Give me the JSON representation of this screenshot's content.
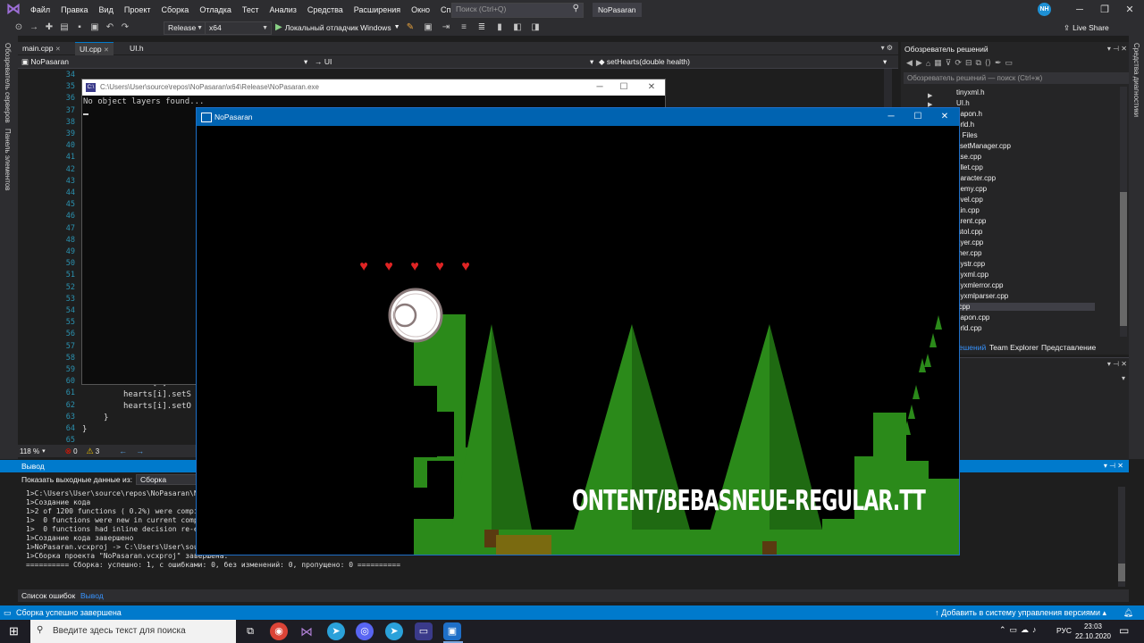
{
  "title_bar": {
    "menus": [
      "Файл",
      "Правка",
      "Вид",
      "Проект",
      "Сборка",
      "Отладка",
      "Тест",
      "Анализ",
      "Средства",
      "Расширения",
      "Окно",
      "Справка"
    ],
    "search_placeholder": "Поиск (Ctrl+Q)",
    "solution_name": "NoPasaran",
    "user_initials": "NH"
  },
  "toolbar": {
    "configuration": "Release",
    "platform": "x64",
    "run_label": "Локальный отладчик Windows",
    "live_share": "Live Share"
  },
  "left_strip": {
    "tab1": "Обозреватель серверов",
    "tab2": "Панель элементов"
  },
  "right_strip": {
    "tab1": "Средства диагностики"
  },
  "editor": {
    "tabs": [
      "main.cpp",
      "UI.cpp",
      "UI.h"
    ],
    "nav": {
      "project": "NoPasaran",
      "scope": "UI",
      "member": "setHearts(double health)"
    },
    "line_numbers": [
      "34",
      "35",
      "36",
      "37",
      "38",
      "39",
      "40",
      "41",
      "42",
      "43",
      "44",
      "45",
      "46",
      "47",
      "48",
      "49",
      "50",
      "51",
      "52",
      "53",
      "54",
      "55",
      "56",
      "57",
      "58",
      "59",
      "60",
      "61",
      "62",
      "63",
      "64",
      "65"
    ],
    "visible_code": [
      {
        "line": "60",
        "text": "hearts[i].setT"
      },
      {
        "line": "61",
        "text": "hearts[i].setS"
      },
      {
        "line": "62",
        "text": "hearts[i].setO"
      },
      {
        "line": "63",
        "text": "}"
      },
      {
        "line": "64",
        "text": "}"
      }
    ],
    "zoom": "118 %",
    "errors": "0",
    "warnings": "3"
  },
  "console_window": {
    "title": "C:\\Users\\User\\source\\repos\\NoPasaran\\x64\\Release\\NoPasaran.exe",
    "output": "No object layers found..."
  },
  "solution_explorer": {
    "title": "Обозреватель решений",
    "search_placeholder": "Обозреватель решений — поиск (Ctrl+ж)",
    "files": [
      "tinyxml.h",
      "UI.h",
      "eapon.h",
      "orld.h",
      "e Files",
      "ssetManager.cpp",
      "ase.cpp",
      "ullet.cpp",
      "haracter.cpp",
      "nemy.cpp",
      "evel.cpp",
      "ain.cpp",
      "arent.cpp",
      "istol.cpp",
      "ayer.cpp",
      "mer.cpp",
      "nystr.cpp",
      "nyxml.cpp",
      "nyxmlerror.cpp",
      "nyxmlparser.cpp",
      "I.cpp",
      "eapon.cpp",
      "orld.cpp"
    ],
    "tabs": [
      "решений",
      "Team Explorer",
      "Представление классов"
    ]
  },
  "output_panel": {
    "title": "Вывод",
    "source_label": "Показать выходные данные из:",
    "source_value": "Сборка",
    "lines": [
      "1>C:\\Users\\User\\source\\repos\\NoPasaran\\No",
      "1>Создание кода",
      "1>2 of 1200 functions ( 0.2%) were compil",
      "1>  0 functions were new in current compi",
      "1>  0 functions had inline decision re-ev",
      "1>Создание кода завершено",
      "1>NoPasaran.vcxproj -> C:\\Users\\User\\sou",
      "1>Сборка проекта \"NoPasaran.vcxproj\" завершена.",
      "========== Сборка: успешно: 1, с ошибками: 0, без изменений: 0, пропущено: 0 =========="
    ]
  },
  "bottom_tabs": [
    "Список ошибок",
    "Вывод"
  ],
  "status_bar": {
    "message": "Сборка успешно завершена",
    "source_control": "Добавить в систему управления версиями"
  },
  "taskbar": {
    "search_placeholder": "Введите здесь текст для поиска",
    "language": "РУС",
    "time": "23:03",
    "date": "22.10.2020"
  },
  "game_window": {
    "title": "NoPasaran",
    "hearts_count": 5,
    "overlay_text": "ONTENT/BEBASNEUE-REGULAR.TT"
  }
}
